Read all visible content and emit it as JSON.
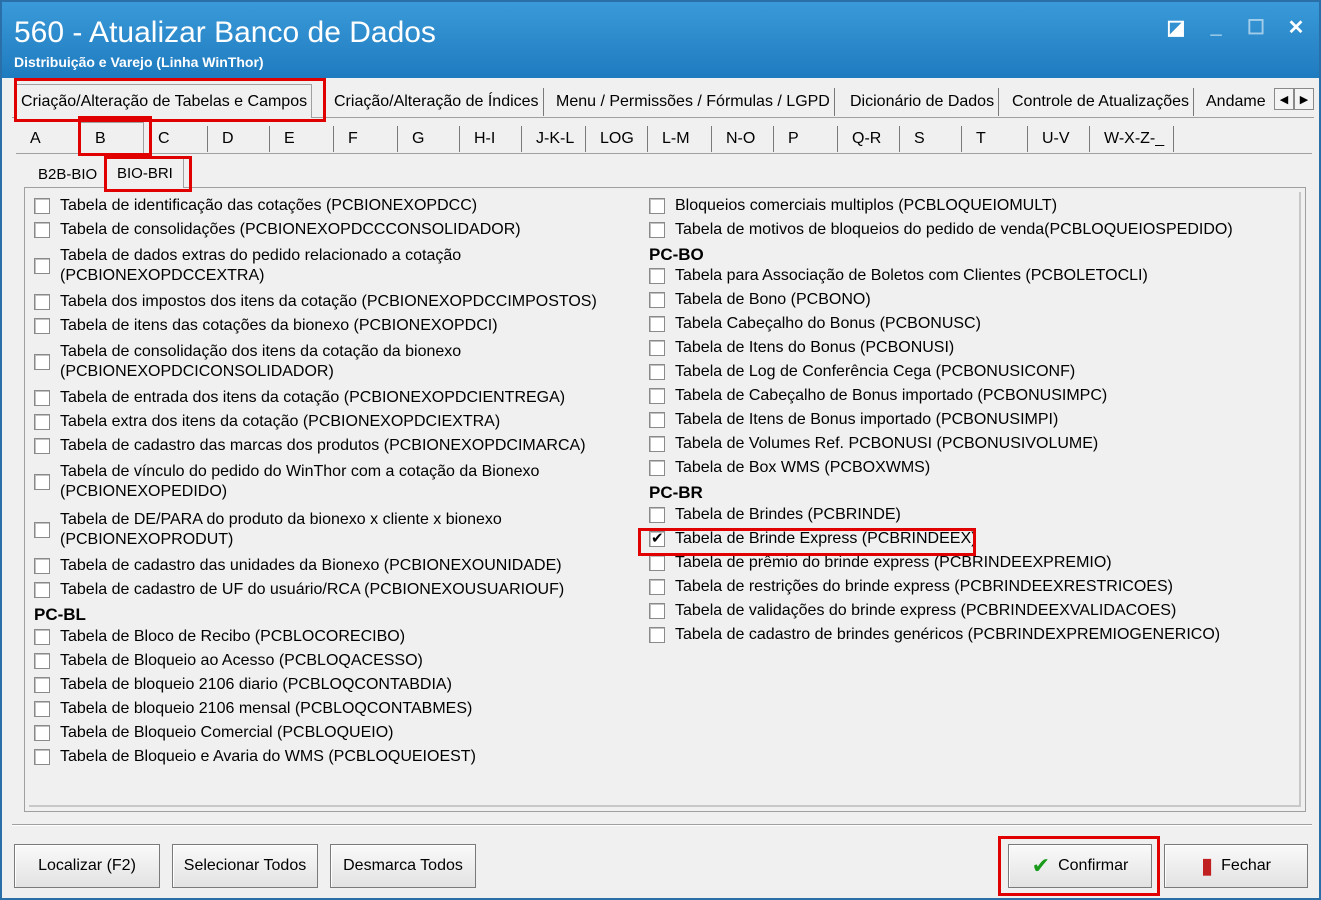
{
  "window": {
    "title": "560 - Atualizar Banco de Dados",
    "subtitle": "Distribuição e Varejo (Linha WinThor)"
  },
  "main_tabs": [
    "Criação/Alteração de Tabelas e Campos",
    "Criação/Alteração de Índices",
    "Menu / Permissões / Fórmulas / LGPD",
    "Dicionário de Dados",
    "Controle de Atualizações",
    "Andame"
  ],
  "letter_tabs": [
    "A",
    "B",
    "C",
    "D",
    "E",
    "F",
    "G",
    "H-I",
    "J-K-L",
    "LOG",
    "L-M",
    "N-O",
    "P",
    "Q-R",
    "S",
    "T",
    "U-V",
    "W-X-Z-_"
  ],
  "sub_tabs": [
    "B2B-BIO",
    "BIO-BRI"
  ],
  "left_column": {
    "items_a": [
      "Tabela de identificação das cotações (PCBIONEXOPDCC)",
      "Tabela de consolidações (PCBIONEXOPDCCCONSOLIDADOR)",
      "Tabela de dados extras do pedido relacionado a cotação\n(PCBIONEXOPDCCEXTRA)",
      "Tabela dos impostos dos itens da cotação (PCBIONEXOPDCCIMPOSTOS)",
      "Tabela de itens das cotações da bionexo (PCBIONEXOPDCI)",
      "Tabela de consolidação dos itens da cotação da bionexo\n(PCBIONEXOPDCICONSOLIDADOR)",
      "Tabela de entrada dos itens da cotação (PCBIONEXOPDCIENTREGA)",
      "Tabela extra dos itens da cotação (PCBIONEXOPDCIEXTRA)",
      "Tabela de cadastro das marcas dos produtos (PCBIONEXOPDCIMARCA)",
      "Tabela de vínculo do pedido do WinThor com a cotação da Bionexo\n(PCBIONEXOPEDIDO)",
      "Tabela de DE/PARA do produto da bionexo x cliente x bionexo\n(PCBIONEXOPRODUT)",
      "Tabela de cadastro das unidades da Bionexo (PCBIONEXOUNIDADE)",
      "Tabela de cadastro de UF do usuário/RCA (PCBIONEXOUSUARIOUF)"
    ],
    "group_bl": "PC-BL",
    "items_bl": [
      "Tabela de Bloco de Recibo (PCBLOCORECIBO)",
      "Tabela de Bloqueio ao Acesso (PCBLOQACESSO)",
      "Tabela de bloqueio 2106 diario (PCBLOQCONTABDIA)",
      "Tabela de bloqueio 2106 mensal (PCBLOQCONTABMES)",
      "Tabela de Bloqueio Comercial (PCBLOQUEIO)",
      "Tabela de Bloqueio e Avaria do WMS (PCBLOQUEIOEST)"
    ]
  },
  "right_column": {
    "items_top": [
      "Bloqueios comerciais multiplos (PCBLOQUEIOMULT)",
      "Tabela de motivos de bloqueios do pedido de venda(PCBLOQUEIOSPEDIDO)"
    ],
    "group_bo": "PC-BO",
    "items_bo": [
      "Tabela para Associação de Boletos com Clientes (PCBOLETOCLI)",
      "Tabela de Bono (PCBONO)",
      "Tabela Cabeçalho do Bonus (PCBONUSC)",
      "Tabela de Itens do Bonus (PCBONUSI)",
      "Tabela de Log de Conferência Cega (PCBONUSICONF)",
      "Tabela de Cabeçalho de Bonus importado (PCBONUSIMPC)",
      "Tabela de Itens de Bonus importado (PCBONUSIMPI)",
      "Tabela de Volumes Ref. PCBONUSI (PCBONUSIVOLUME)",
      "Tabela de Box WMS (PCBOXWMS)"
    ],
    "group_br": "PC-BR",
    "items_br": [
      "Tabela de Brindes (PCBRINDE)",
      "Tabela de Brinde Express (PCBRINDEEX)",
      "Tabela de prêmio do brinde express (PCBRINDEEXPREMIO)",
      "Tabela de restrições do brinde express (PCBRINDEEXRESTRICOES)",
      "Tabela de validações do brinde express (PCBRINDEEXVALIDACOES)",
      "Tabela de cadastro de brindes genéricos (PCBRINDEXPREMIOGENERICO)"
    ]
  },
  "buttons": {
    "localizar": "Localizar (F2)",
    "selecionar": "Selecionar Todos",
    "desmarca": "Desmarca Todos",
    "confirmar": "Confirmar",
    "fechar": "Fechar"
  },
  "colors": {
    "titlebar": "#1f7bbf",
    "highlight": "#e00000"
  },
  "icons": [
    "restore-icon",
    "minimize-icon",
    "maximize-icon",
    "close-icon",
    "check-icon",
    "exit-door-icon",
    "scroll-left-icon",
    "scroll-right-icon"
  ]
}
